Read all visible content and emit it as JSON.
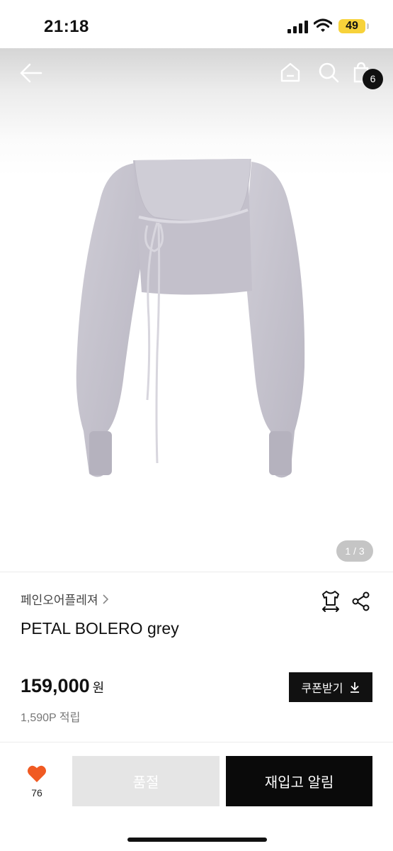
{
  "status_bar": {
    "time": "21:18",
    "battery": "49"
  },
  "header": {
    "cart_count": "6"
  },
  "gallery": {
    "page_indicator": "1 / 3"
  },
  "product": {
    "brand": "페인오어플레져",
    "name": "PETAL BOLERO grey",
    "price": "159,000",
    "currency": "원",
    "points": "1,590P 적립"
  },
  "buttons": {
    "coupon": "쿠폰받기",
    "sold_out": "품절",
    "restock": "재입고 알림"
  },
  "wishlist": {
    "count": "76"
  },
  "colors": {
    "accent": "#f05a22",
    "dark": "#111111",
    "sold_out_bg": "#e5e5e5"
  },
  "icons": [
    "back-arrow-icon",
    "home-icon",
    "search-icon",
    "shopping-bag-icon",
    "size-guide-icon",
    "share-icon",
    "heart-icon",
    "download-icon"
  ]
}
